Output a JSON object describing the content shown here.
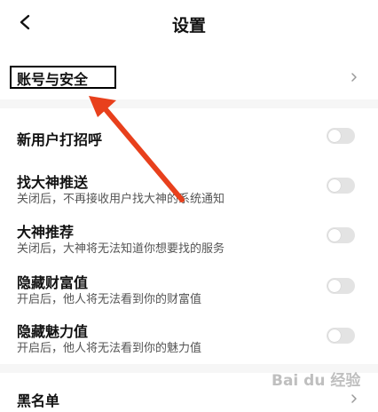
{
  "header": {
    "title": "设置",
    "back_icon": "chevron-left-icon"
  },
  "account_security": {
    "label": "账号与安全",
    "chevron_icon": "chevron-right-icon"
  },
  "toggles": [
    {
      "label": "新用户打招呼",
      "desc": "",
      "on": false
    },
    {
      "label": "找大神推送",
      "desc": "关闭后，不再接收用户找大神的系统通知",
      "on": false
    },
    {
      "label": "大神推荐",
      "desc": "关闭后，大神将无法知道你想要找的服务",
      "on": false
    },
    {
      "label": "隐藏财富值",
      "desc": "开启后，他人将无法看到你的财富值",
      "on": false
    },
    {
      "label": "隐藏魅力值",
      "desc": "开启后，他人将无法看到你的魅力值",
      "on": false
    }
  ],
  "blacklist": {
    "label": "黑名单",
    "chevron_icon": "chevron-right-icon"
  },
  "annotation": {
    "arrow_color": "#e8401c",
    "box_color": "#000000"
  },
  "watermark": {
    "text": "Bai du 经验"
  },
  "colors": {
    "toggle_off": "#e3e3e3",
    "divider": "#f6f6f6"
  }
}
